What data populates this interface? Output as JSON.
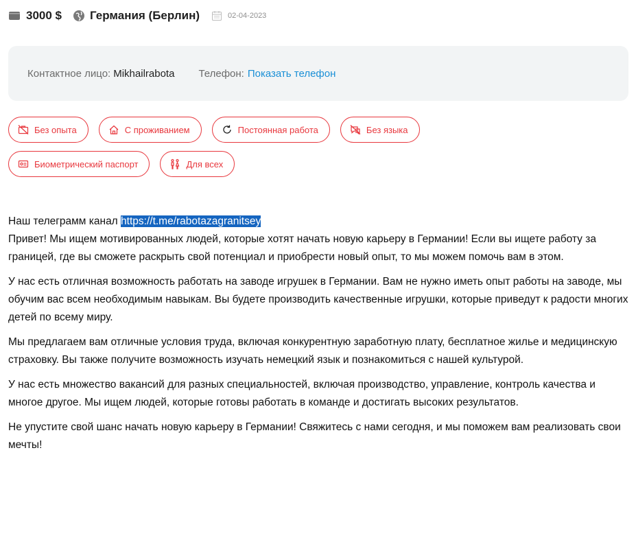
{
  "header": {
    "salary": "3000 $",
    "location": "Германия (Берлин)",
    "date": "02-04-2023"
  },
  "contact": {
    "person_label": "Контактное лицо:",
    "person_name": "Mikhailrabota",
    "phone_label": "Телефон:",
    "phone_link": "Показать телефон"
  },
  "tags": [
    {
      "label": "Без опыта",
      "icon": "briefcase-crossed-icon"
    },
    {
      "label": "С проживанием",
      "icon": "house-icon"
    },
    {
      "label": "Постоянная работа",
      "icon": "refresh-icon"
    },
    {
      "label": "Без языка",
      "icon": "speech-crossed-icon"
    },
    {
      "label": "Биометрический паспорт",
      "icon": "passport-icon"
    },
    {
      "label": "Для всех",
      "icon": "people-icon"
    }
  ],
  "description": {
    "telegram_prefix": "Наш телеграмм канал",
    "telegram_link": "https://t.me/rabotazagranitsey",
    "p1": "Привет! Мы ищем мотивированных людей, которые хотят начать новую карьеру в Германии! Если вы ищете работу за границей, где вы сможете раскрыть свой потенциал и приобрести новый опыт, то мы можем помочь вам в этом.",
    "p2": "У нас есть отличная возможность работать на заводе игрушек в Германии. Вам не нужно иметь опыт работы на заводе, мы обучим вас всем необходимым навыкам. Вы будете производить качественные игрушки, которые приведут к радости многих детей по всему миру.",
    "p3": "Мы предлагаем вам отличные условия труда, включая конкурентную заработную плату, бесплатное жилье и медицинскую страховку. Вы также получите возможность изучать немецкий язык и познакомиться с нашей культурой.",
    "p4": "У нас есть множество вакансий для разных специальностей, включая производство, управление, контроль качества и многое другое. Мы ищем людей, которые готовы работать в команде и достигать высоких результатов.",
    "p5": "Не упустите свой шанс начать новую карьеру в Германии! Свяжитесь с нами сегодня, и мы поможем вам реализовать свои мечты!"
  },
  "colors": {
    "accent_red": "#e8373d",
    "link_blue": "#1a8fd6",
    "selection_blue": "#1565c0",
    "panel_gray": "#f2f4f5"
  }
}
